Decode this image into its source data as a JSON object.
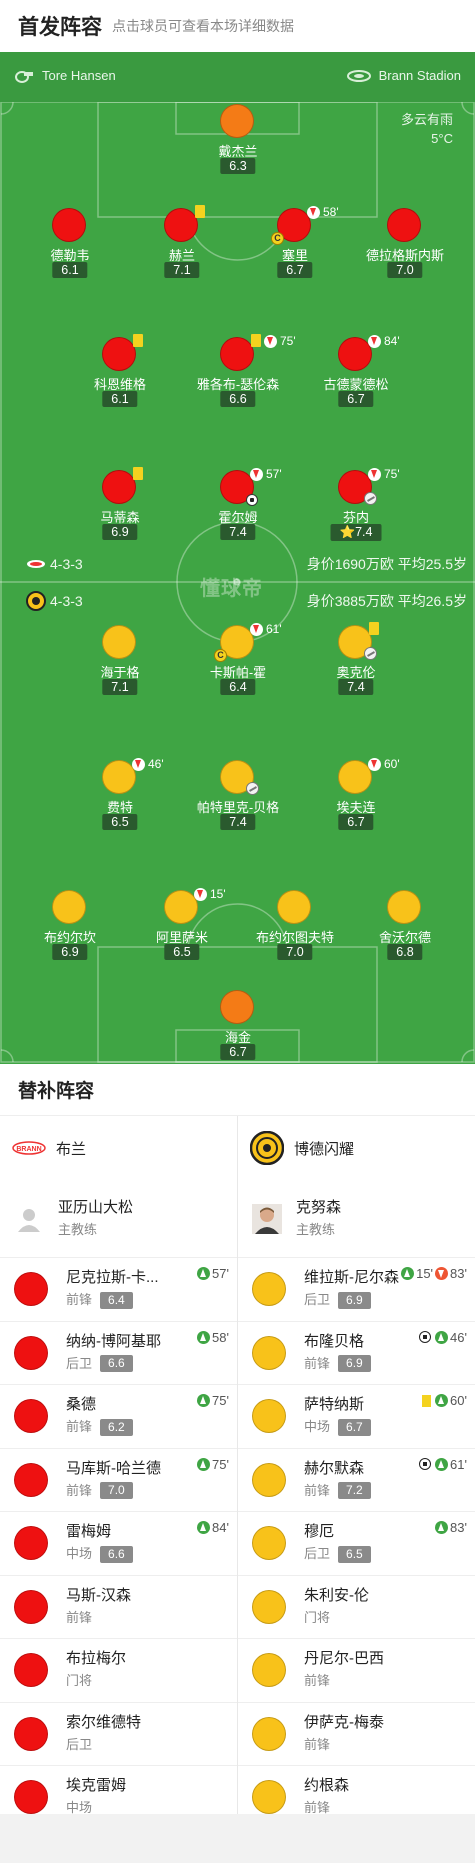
{
  "header": {
    "title": "首发阵容",
    "subtitle": "点击球员可查看本场详细数据"
  },
  "pitch": {
    "referee": "Tore Hansen",
    "stadium": "Brann Stadion",
    "weather": "多云有雨",
    "temperature": "5°C",
    "watermark": "懂球帝",
    "colors": {
      "grass": "#3fa544",
      "home_kit": "#ee1111",
      "away_kit": "#f8c21a",
      "gk_kit": "#f47b16"
    },
    "home": {
      "formation": "4-3-3",
      "value": "身价1690万欧  平均25.5岁"
    },
    "away": {
      "formation": "4-3-3",
      "value": "身价3885万欧  平均26.5岁"
    },
    "players": [
      {
        "name": "戴杰兰",
        "rating": "6.3",
        "kit": "gk"
      },
      {
        "name": "德勒韦",
        "rating": "6.1",
        "kit": "home"
      },
      {
        "name": "赫兰",
        "rating": "7.1",
        "kit": "home",
        "yellow": true
      },
      {
        "name": "塞里",
        "rating": "6.7",
        "kit": "home",
        "sub_min": "58'",
        "captain": true
      },
      {
        "name": "德拉格斯内斯",
        "rating": "7.0",
        "kit": "home"
      },
      {
        "name": "科恩维格",
        "rating": "6.1",
        "kit": "home",
        "yellow": true
      },
      {
        "name": "雅各布-瑟伦森",
        "rating": "6.6",
        "kit": "home",
        "yellow": true,
        "sub_min": "75'"
      },
      {
        "name": "古德蒙德松",
        "rating": "6.7",
        "kit": "home",
        "sub_min": "84'"
      },
      {
        "name": "马蒂森",
        "rating": "6.9",
        "kit": "home",
        "yellow": true
      },
      {
        "name": "霍尔姆",
        "rating": "7.4",
        "kit": "home",
        "sub_min": "57'",
        "goal": true
      },
      {
        "name": "芬内",
        "rating": "7.4",
        "kit": "home",
        "sub_min": "75'",
        "assist": true,
        "star": true
      },
      {
        "name": "海于格",
        "rating": "7.1",
        "kit": "away"
      },
      {
        "name": "卡斯帕-霍",
        "rating": "6.4",
        "kit": "away",
        "sub_min": "61'",
        "captain": true
      },
      {
        "name": "奥克伦",
        "rating": "7.4",
        "kit": "away",
        "yellow": true,
        "assist": true
      },
      {
        "name": "费特",
        "rating": "6.5",
        "kit": "away",
        "sub_min": "46'"
      },
      {
        "name": "帕特里克-贝格",
        "rating": "7.4",
        "kit": "away",
        "assist": true
      },
      {
        "name": "埃夫连",
        "rating": "6.7",
        "kit": "away",
        "sub_min": "60'"
      },
      {
        "name": "布约尔坎",
        "rating": "6.9",
        "kit": "away"
      },
      {
        "name": "阿里萨米",
        "rating": "6.5",
        "kit": "away",
        "sub_min": "15'"
      },
      {
        "name": "布约尔图夫特",
        "rating": "7.0",
        "kit": "away"
      },
      {
        "name": "舍沃尔德",
        "rating": "6.8",
        "kit": "away"
      },
      {
        "name": "海金",
        "rating": "6.7",
        "kit": "gk"
      }
    ]
  },
  "bench": {
    "title": "替补阵容",
    "home": {
      "team": "布兰",
      "coach": {
        "name": "亚历山大松",
        "role": "主教练"
      },
      "subs": [
        {
          "name": "尼克拉斯-卡...",
          "pos": "前锋",
          "rating": "6.4",
          "events": [
            {
              "type": "in",
              "min": "57'"
            }
          ]
        },
        {
          "name": "纳纳-博阿基耶",
          "pos": "后卫",
          "rating": "6.6",
          "events": [
            {
              "type": "in",
              "min": "58'"
            }
          ]
        },
        {
          "name": "桑德",
          "pos": "前锋",
          "rating": "6.2",
          "events": [
            {
              "type": "in",
              "min": "75'"
            }
          ]
        },
        {
          "name": "马库斯-哈兰德",
          "pos": "前锋",
          "rating": "7.0",
          "events": [
            {
              "type": "in",
              "min": "75'"
            }
          ]
        },
        {
          "name": "雷梅姆",
          "pos": "中场",
          "rating": "6.6",
          "events": [
            {
              "type": "in",
              "min": "84'"
            }
          ]
        },
        {
          "name": "马斯-汉森",
          "pos": "前锋",
          "rating": "",
          "events": []
        },
        {
          "name": "布拉梅尔",
          "pos": "门将",
          "rating": "",
          "events": []
        },
        {
          "name": "索尔维德特",
          "pos": "后卫",
          "rating": "",
          "events": []
        },
        {
          "name": "埃克雷姆",
          "pos": "中场",
          "rating": "",
          "events": []
        }
      ]
    },
    "away": {
      "team": "博德闪耀",
      "coach": {
        "name": "克努森",
        "role": "主教练"
      },
      "subs": [
        {
          "name": "维拉斯-尼尔森",
          "pos": "后卫",
          "rating": "6.9",
          "events": [
            {
              "type": "in",
              "min": "15'"
            },
            {
              "type": "out",
              "min": "83'"
            }
          ]
        },
        {
          "name": "布隆贝格",
          "pos": "前锋",
          "rating": "6.9",
          "events": [
            {
              "type": "goal",
              "min": ""
            },
            {
              "type": "in",
              "min": "46'"
            }
          ]
        },
        {
          "name": "萨特纳斯",
          "pos": "中场",
          "rating": "6.7",
          "events": [
            {
              "type": "yellow",
              "min": ""
            },
            {
              "type": "in",
              "min": "60'"
            }
          ]
        },
        {
          "name": "赫尔默森",
          "pos": "前锋",
          "rating": "7.2",
          "events": [
            {
              "type": "goal",
              "min": ""
            },
            {
              "type": "in",
              "min": "61'"
            }
          ]
        },
        {
          "name": "穆厄",
          "pos": "后卫",
          "rating": "6.5",
          "events": [
            {
              "type": "in",
              "min": "83'"
            }
          ]
        },
        {
          "name": "朱利安-伦",
          "pos": "门将",
          "rating": "",
          "events": []
        },
        {
          "name": "丹尼尔-巴西",
          "pos": "前锋",
          "rating": "",
          "events": []
        },
        {
          "name": "伊萨克-梅泰",
          "pos": "前锋",
          "rating": "",
          "events": []
        },
        {
          "name": "约根森",
          "pos": "前锋",
          "rating": "",
          "events": []
        }
      ]
    }
  }
}
